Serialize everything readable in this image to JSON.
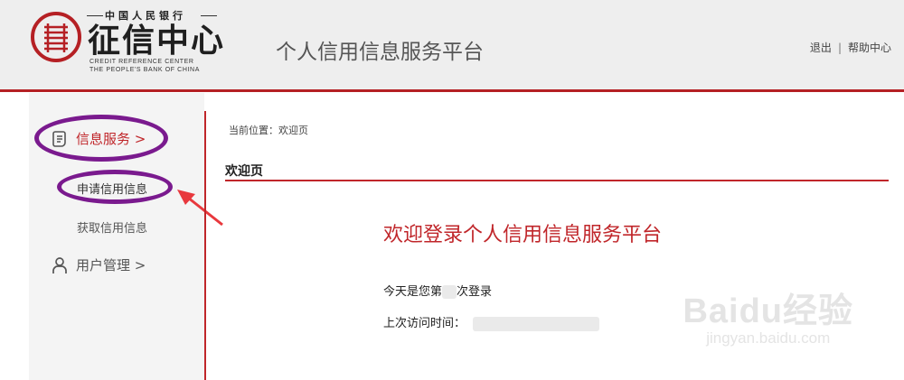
{
  "header": {
    "logo_top_text": "中国人民银行",
    "logo_main_text": "征信中心",
    "logo_en_line1": "CREDIT REFERENCE CENTER",
    "logo_en_line2": "THE PEOPLE'S BANK OF CHINA",
    "platform_title": "个人信用信息服务平台",
    "links": {
      "logout": "退出",
      "separator": "|",
      "help": "帮助中心"
    },
    "accent_color": "#c0262a"
  },
  "sidebar": {
    "items": [
      {
        "label": "信息服务 >",
        "icon": "document-icon",
        "active": true,
        "children": [
          {
            "label": "申请信用信息",
            "active": true
          },
          {
            "label": "获取信用信息",
            "active": false
          }
        ]
      },
      {
        "label": "用户管理 >",
        "icon": "user-icon",
        "active": false
      }
    ]
  },
  "main": {
    "breadcrumb": "当前位置：欢迎页",
    "page_title": "欢迎页",
    "welcome_heading": "欢迎登录个人信用信息服务平台",
    "login_count_prefix": "今天是您第",
    "login_count_suffix": "次登录",
    "last_visit_label": "上次访问时间："
  },
  "annotations": {
    "ellipse_color": "#7a1a8e",
    "arrow_color": "#e8383d"
  },
  "watermark": {
    "brand": "Baidu经验",
    "url": "jingyan.baidu.com"
  }
}
